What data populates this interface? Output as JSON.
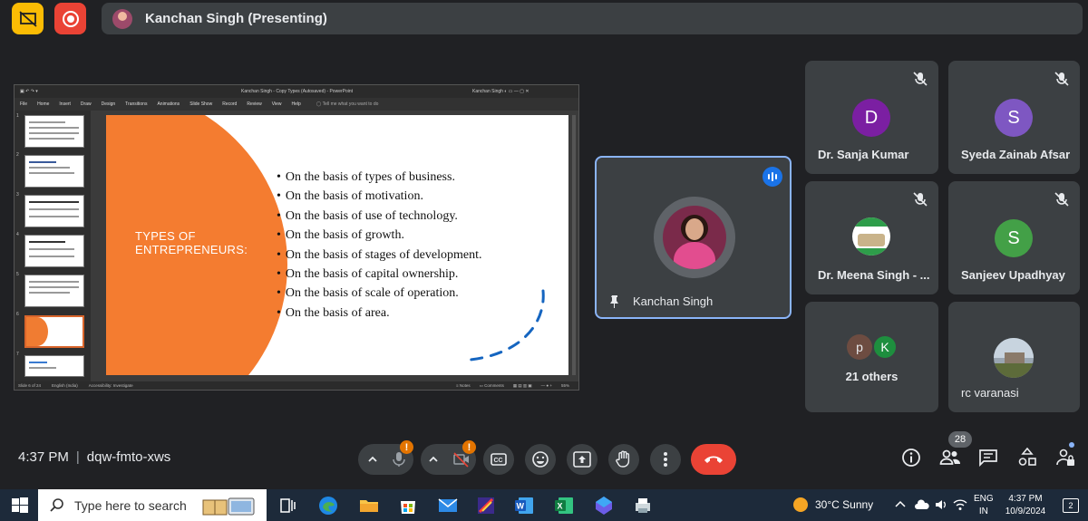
{
  "presenter_bar": {
    "label": "Kanchan Singh (Presenting)"
  },
  "slide": {
    "title": "TYPES OF\nENTREPRENEURS:",
    "bullets": [
      "On the basis of types of business.",
      "On the basis of motivation.",
      "On the basis of use of technology.",
      "On the basis of growth.",
      "On the basis of stages of development.",
      "On the basis of capital ownership.",
      "On the basis of scale of operation.",
      "On the basis of area."
    ],
    "colors": {
      "accent": "#f47c30"
    }
  },
  "participants": {
    "dk": {
      "initial": "D",
      "name": "Dr. Sanja Kumar",
      "color": "#7b1fa2"
    },
    "sz": {
      "initial": "S",
      "name": "Syeda Zainab Afsar",
      "color": "#7e57c2"
    },
    "ms": {
      "name": "Dr. Meena Singh - ..."
    },
    "su": {
      "initial": "S",
      "name": "Sanjeev Upadhyay",
      "color": "#43a047"
    },
    "kc": {
      "name": "Kanchan Singh"
    },
    "others": {
      "initials": [
        "p",
        "K"
      ],
      "label": "21 others"
    },
    "rc": {
      "name": "rc varanasi"
    }
  },
  "meeting": {
    "time": "4:37 PM",
    "code": "dqw-fmto-xws",
    "participant_count": "28",
    "warning_mark": "!"
  },
  "taskbar": {
    "search_placeholder": "Type here to search",
    "weather": "30°C  Sunny",
    "lang_top": "ENG",
    "lang_bottom": "IN",
    "clock_time": "4:37 PM",
    "clock_date": "10/9/2024",
    "notifications": "2"
  }
}
